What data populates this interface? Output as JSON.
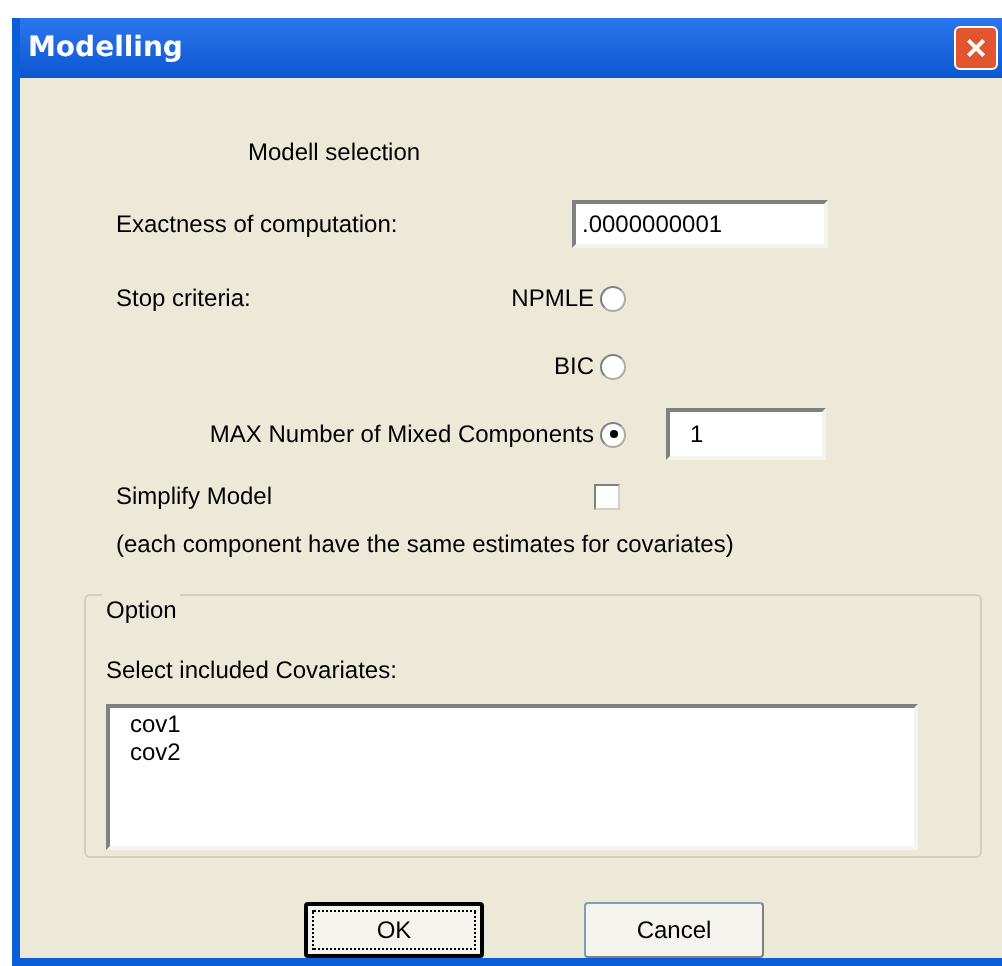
{
  "window": {
    "title": "Modelling",
    "close": "×"
  },
  "heading": "Modell selection",
  "exactness": {
    "label": "Exactness of computation:",
    "value": ".0000000001"
  },
  "stop_criteria": {
    "label": "Stop criteria:",
    "options": [
      {
        "label": "NPMLE",
        "selected": false
      },
      {
        "label": "BIC",
        "selected": false
      },
      {
        "label": "MAX Number of Mixed Components",
        "selected": true,
        "value": "1"
      }
    ]
  },
  "simplify": {
    "label": "Simplify Model",
    "checked": false,
    "note": "(each component have the same estimates for covariates)"
  },
  "option_group": {
    "title": "Option",
    "list_label": "Select included Covariates:",
    "items": [
      "cov1",
      "cov2"
    ]
  },
  "buttons": [
    {
      "label": "OK",
      "default": true
    },
    {
      "label": "Cancel",
      "default": false
    }
  ]
}
